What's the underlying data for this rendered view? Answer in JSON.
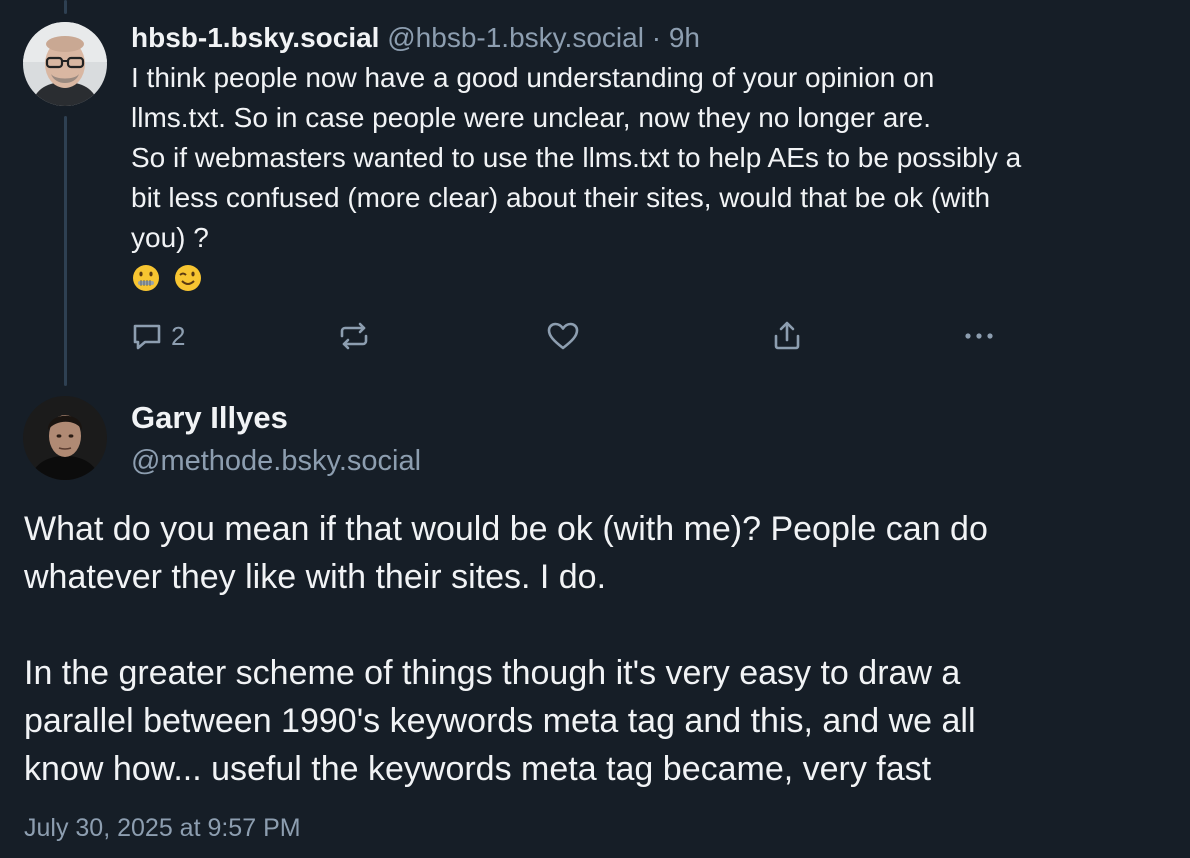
{
  "parent_post": {
    "display_name": "hbsb-1.bsky.social",
    "handle": "@hbsb-1.bsky.social",
    "separator": " · ",
    "time_ago": "9h",
    "text": "I think people now have a good understanding of your opinion on\nllms.txt. So in case people were unclear, now they no longer are.\nSo if webmasters wanted to use the llms.txt to help AEs to be possibly a\nbit less confused (more clear) about their sites, would that be ok (with\nyou) ?",
    "emojis": [
      "zipper-mouth-face",
      "winking-face"
    ],
    "actions": {
      "reply_count": "2",
      "repost_count": "",
      "like_count": ""
    }
  },
  "main_post": {
    "display_name": "Gary Illyes",
    "handle": "@methode.bsky.social",
    "text": "What do you mean if that would be ok (with me)? People can do\nwhatever they like with their sites. I do.\n\nIn the greater scheme of things though it's very easy to draw a\nparallel between 1990's keywords meta tag and this, and we all\nknow how... useful the keywords meta tag became, very fast",
    "timestamp": "July 30, 2025 at 9:57 PM"
  },
  "colors": {
    "background": "#161e27",
    "text_primary": "#f1f3f5",
    "text_secondary": "#8d9eb0",
    "thread_line": "#2e4052"
  }
}
